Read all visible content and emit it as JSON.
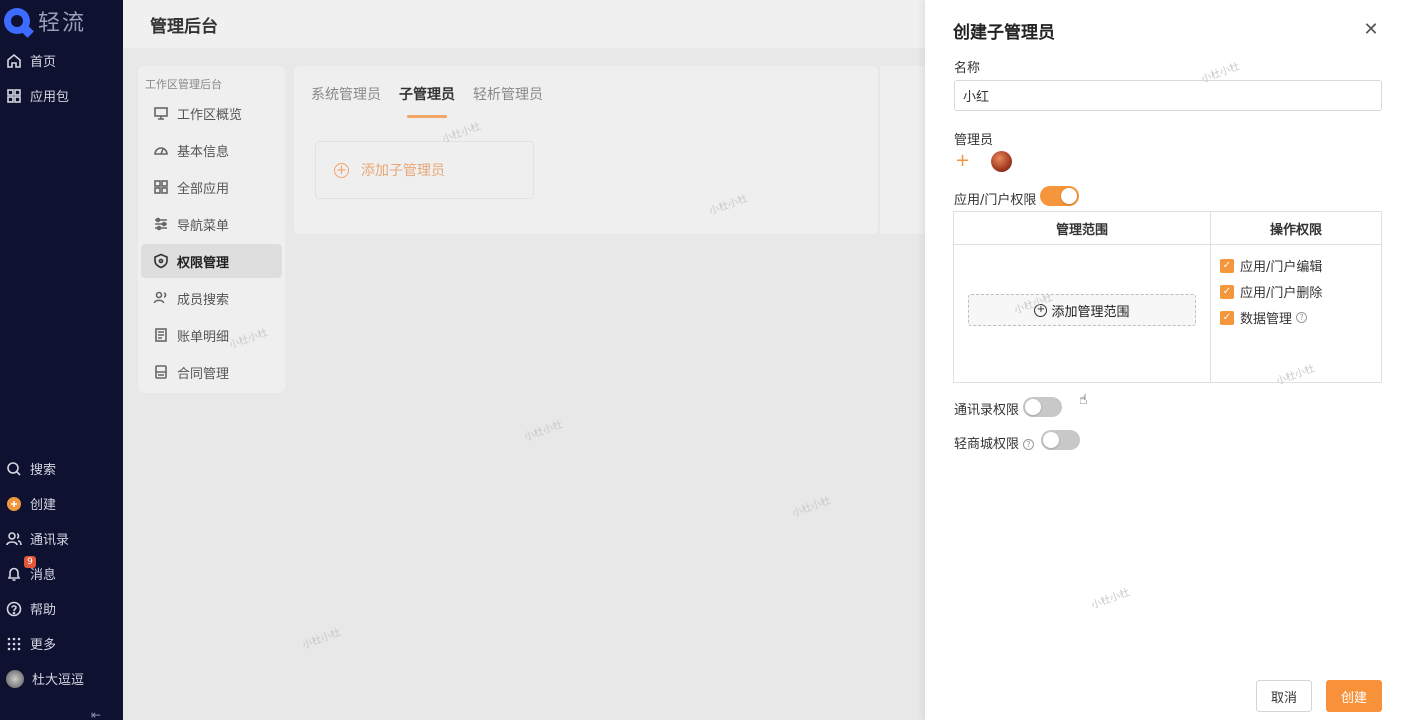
{
  "app": {
    "name": "轻流"
  },
  "sidebar": {
    "top_items": [
      {
        "label": "首页",
        "icon": "home-icon"
      },
      {
        "label": "应用包",
        "icon": "grid-icon"
      }
    ],
    "bottom_items": [
      {
        "label": "搜索",
        "icon": "search-icon"
      },
      {
        "label": "创建",
        "icon": "plus-circle-icon"
      },
      {
        "label": "通讯录",
        "icon": "contacts-icon"
      },
      {
        "label": "消息",
        "icon": "bell-icon",
        "badge": "9"
      },
      {
        "label": "帮助",
        "icon": "help-icon"
      },
      {
        "label": "更多",
        "icon": "apps-icon"
      },
      {
        "label": "杜大逗逗",
        "icon": "user-avatar"
      }
    ]
  },
  "main": {
    "title": "管理后台",
    "menu_title": "工作区管理后台",
    "menu_items": [
      {
        "label": "工作区概览",
        "icon": "monitor-icon"
      },
      {
        "label": "基本信息",
        "icon": "gauge-icon"
      },
      {
        "label": "全部应用",
        "icon": "apps-grid-icon"
      },
      {
        "label": "导航菜单",
        "icon": "sliders-icon"
      },
      {
        "label": "权限管理",
        "icon": "shield-icon",
        "active": true
      },
      {
        "label": "成员搜索",
        "icon": "members-icon"
      },
      {
        "label": "账单明细",
        "icon": "bill-icon"
      },
      {
        "label": "合同管理",
        "icon": "contract-icon"
      }
    ],
    "tabs": [
      {
        "label": "系统管理员"
      },
      {
        "label": "子管理员",
        "active": true
      },
      {
        "label": "轻析管理员"
      }
    ],
    "add_sub_admin": "添加子管理员",
    "watermark": "小杜小杜"
  },
  "drawer": {
    "title": "创建子管理员",
    "name_label": "名称",
    "name_value": "小红",
    "admins_label": "管理员",
    "app_perm_label": "应用/门户权限",
    "app_perm_on": true,
    "table": {
      "col_scope": "管理范围",
      "col_ops": "操作权限",
      "add_scope": "添加管理范围",
      "ops": [
        {
          "label": "应用/门户编辑",
          "checked": true
        },
        {
          "label": "应用/门户删除",
          "checked": true
        },
        {
          "label": "数据管理",
          "checked": true,
          "help": true
        }
      ]
    },
    "contacts_perm_label": "通讯录权限",
    "contacts_perm_on": false,
    "mall_perm_label": "轻商城权限",
    "mall_perm_on": false,
    "cancel": "取消",
    "create": "创建"
  },
  "colors": {
    "accent": "#f5963c",
    "sidebar_bg": "#0e1130"
  }
}
